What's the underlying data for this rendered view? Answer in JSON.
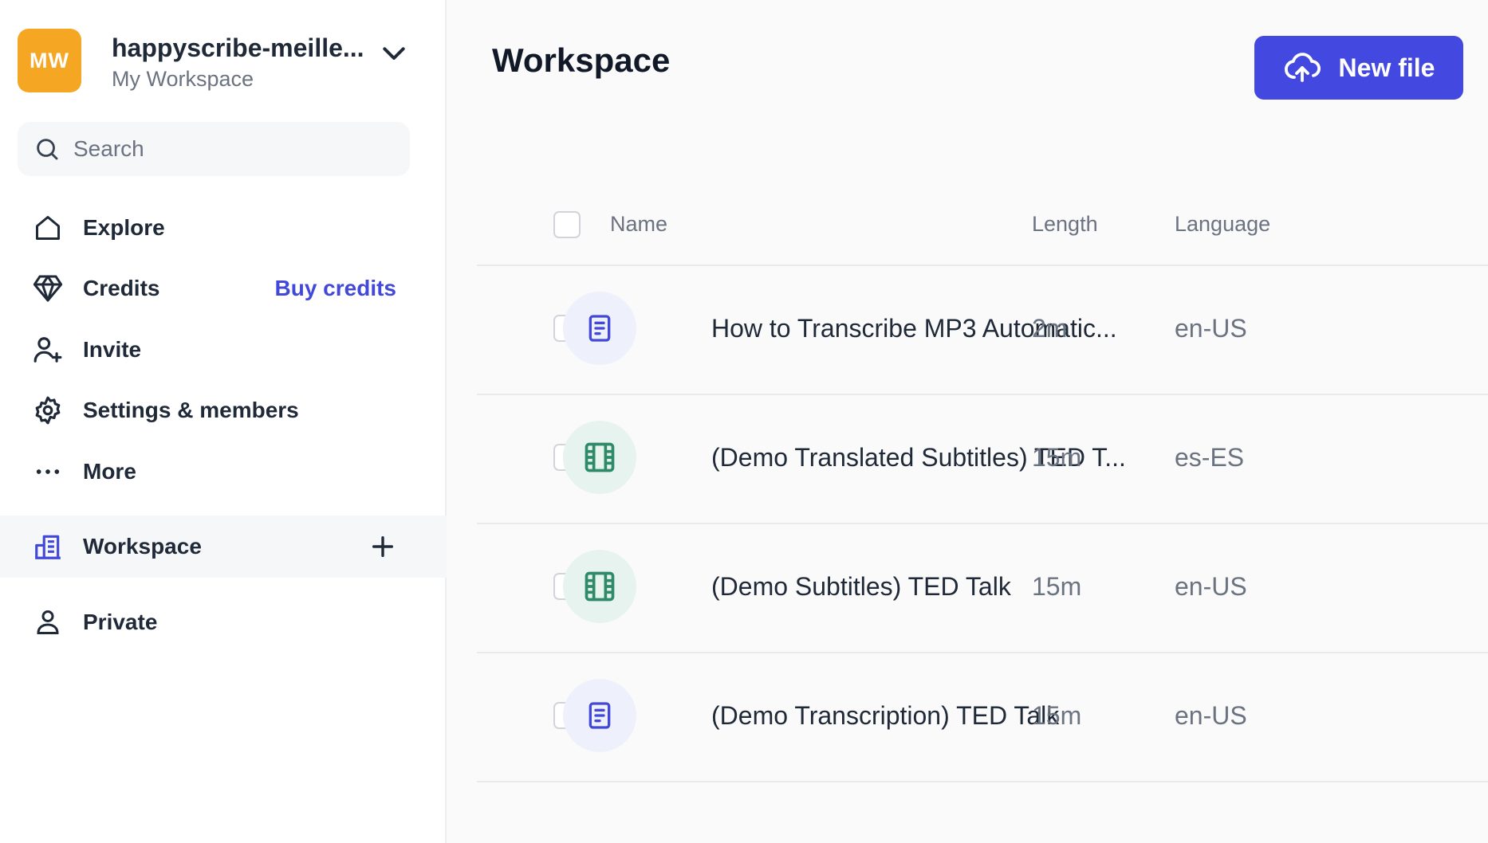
{
  "workspace": {
    "avatar_initials": "MW",
    "name": "happyscribe-meille...",
    "subtitle": "My Workspace"
  },
  "search": {
    "placeholder": "Search"
  },
  "nav": {
    "explore": "Explore",
    "credits": "Credits",
    "buy_credits": "Buy credits",
    "invite": "Invite",
    "settings": "Settings & members",
    "more": "More",
    "workspace": "Workspace",
    "private": "Private"
  },
  "main": {
    "title": "Workspace",
    "new_file_label": "New file"
  },
  "table": {
    "columns": {
      "name": "Name",
      "length": "Length",
      "language": "Language"
    },
    "rows": [
      {
        "icon": "document-icon",
        "name": "How to Transcribe MP3 Automatic...",
        "length": "2m",
        "language": "en-US"
      },
      {
        "icon": "film-icon",
        "name": "(Demo Translated Subtitles) TED T...",
        "length": "15m",
        "language": "es-ES"
      },
      {
        "icon": "film-icon",
        "name": "(Demo Subtitles) TED Talk",
        "length": "15m",
        "language": "en-US"
      },
      {
        "icon": "document-icon",
        "name": "(Demo Transcription) TED Talk",
        "length": "15m",
        "language": "en-US"
      }
    ]
  },
  "colors": {
    "accent": "#4248e0",
    "avatar": "#f5a623",
    "doc_icon": "#4248d8",
    "video_icon": "#2f8a6a"
  }
}
